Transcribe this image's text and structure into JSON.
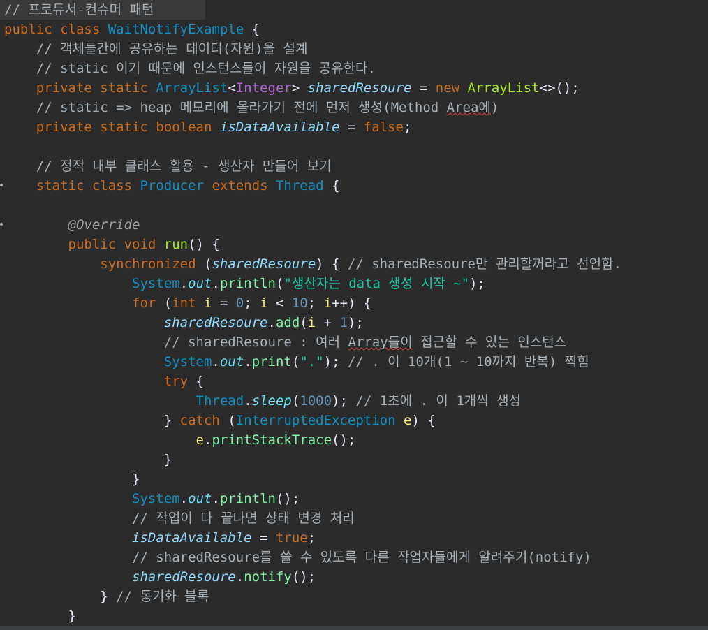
{
  "editor": {
    "lines": [
      [
        {
          "t": "// 프로듀서-컨슈머 패턴",
          "c": "c"
        }
      ],
      [
        {
          "t": "public ",
          "c": "k"
        },
        {
          "t": "class ",
          "c": "k"
        },
        {
          "t": "WaitNotifyExample",
          "c": "cls"
        },
        {
          "t": " {",
          "c": "plain"
        }
      ],
      [
        {
          "t": "    // 객체들간에 공유하는 데이터(자원)을 설계",
          "c": "c"
        }
      ],
      [
        {
          "t": "    // static 이기 때문에 인스턴스들이 자원을 공유한다.",
          "c": "c"
        }
      ],
      [
        {
          "t": "    private ",
          "c": "k"
        },
        {
          "t": "static ",
          "c": "k"
        },
        {
          "t": "ArrayList",
          "c": "cls"
        },
        {
          "t": "<",
          "c": "plain"
        },
        {
          "t": "Integer",
          "c": "gen"
        },
        {
          "t": "> ",
          "c": "plain"
        },
        {
          "t": "sharedResoure",
          "c": "sv"
        },
        {
          "t": " = ",
          "c": "plain"
        },
        {
          "t": "new ",
          "c": "k"
        },
        {
          "t": "ArrayList",
          "c": "m"
        },
        {
          "t": "<>();",
          "c": "plain"
        }
      ],
      [
        {
          "t": "    // static => heap 메모리에 올라가기 전에 먼저 생성(Method ",
          "c": "c"
        },
        {
          "t": "Area에",
          "c": "c",
          "u": true
        },
        {
          "t": ")",
          "c": "c"
        }
      ],
      [
        {
          "t": "    private ",
          "c": "k"
        },
        {
          "t": "static ",
          "c": "k"
        },
        {
          "t": "boolean ",
          "c": "k"
        },
        {
          "t": "isDataAvailable",
          "c": "sv"
        },
        {
          "t": " = ",
          "c": "plain"
        },
        {
          "t": "false",
          "c": "k"
        },
        {
          "t": ";",
          "c": "plain"
        }
      ],
      [
        {
          "t": "",
          "c": "plain"
        }
      ],
      [
        {
          "t": "    // 정적 내부 클래스 활용 - 생산자 만들어 보기",
          "c": "c"
        }
      ],
      [
        {
          "t": "    static ",
          "c": "k"
        },
        {
          "t": "class ",
          "c": "k"
        },
        {
          "t": "Producer ",
          "c": "cls"
        },
        {
          "t": "extends ",
          "c": "k"
        },
        {
          "t": "Thread",
          "c": "cls"
        },
        {
          "t": " {",
          "c": "plain"
        }
      ],
      [
        {
          "t": "",
          "c": "plain"
        }
      ],
      [
        {
          "t": "        @Override",
          "c": "ann"
        }
      ],
      [
        {
          "t": "        public ",
          "c": "k"
        },
        {
          "t": "void ",
          "c": "k"
        },
        {
          "t": "run",
          "c": "m"
        },
        {
          "t": "() {",
          "c": "plain"
        }
      ],
      [
        {
          "t": "            synchronized ",
          "c": "k"
        },
        {
          "t": "(",
          "c": "plain"
        },
        {
          "t": "sharedResoure",
          "c": "sv"
        },
        {
          "t": ") { ",
          "c": "plain"
        },
        {
          "t": "// sharedResoure만 관리할꺼라고 선언함.",
          "c": "c"
        }
      ],
      [
        {
          "t": "                System",
          "c": "cls"
        },
        {
          "t": ".",
          "c": "plain"
        },
        {
          "t": "out",
          "c": "fld"
        },
        {
          "t": ".",
          "c": "plain"
        },
        {
          "t": "println",
          "c": "m2"
        },
        {
          "t": "(",
          "c": "plain"
        },
        {
          "t": "\"생산자는 data 생성 시작 ~\"",
          "c": "str"
        },
        {
          "t": ");",
          "c": "plain"
        }
      ],
      [
        {
          "t": "                for ",
          "c": "k"
        },
        {
          "t": "(",
          "c": "plain"
        },
        {
          "t": "int ",
          "c": "k"
        },
        {
          "t": "i",
          "c": "var"
        },
        {
          "t": " = ",
          "c": "plain"
        },
        {
          "t": "0",
          "c": "num"
        },
        {
          "t": "; ",
          "c": "plain"
        },
        {
          "t": "i",
          "c": "var"
        },
        {
          "t": " < ",
          "c": "plain"
        },
        {
          "t": "10",
          "c": "num"
        },
        {
          "t": "; ",
          "c": "plain"
        },
        {
          "t": "i",
          "c": "var"
        },
        {
          "t": "++) {",
          "c": "plain"
        }
      ],
      [
        {
          "t": "                    sharedResoure",
          "c": "sv"
        },
        {
          "t": ".",
          "c": "plain"
        },
        {
          "t": "add",
          "c": "m2"
        },
        {
          "t": "(",
          "c": "plain"
        },
        {
          "t": "i",
          "c": "var"
        },
        {
          "t": " + ",
          "c": "plain"
        },
        {
          "t": "1",
          "c": "num"
        },
        {
          "t": ");",
          "c": "plain"
        }
      ],
      [
        {
          "t": "                    // sharedResoure : 여러 ",
          "c": "c"
        },
        {
          "t": "Array들이",
          "c": "c",
          "u": true
        },
        {
          "t": " 접근할 수 있는 인스턴스",
          "c": "c"
        }
      ],
      [
        {
          "t": "                    System",
          "c": "cls"
        },
        {
          "t": ".",
          "c": "plain"
        },
        {
          "t": "out",
          "c": "fld"
        },
        {
          "t": ".",
          "c": "plain"
        },
        {
          "t": "print",
          "c": "m2"
        },
        {
          "t": "(",
          "c": "plain"
        },
        {
          "t": "\".\"",
          "c": "str"
        },
        {
          "t": "); ",
          "c": "plain"
        },
        {
          "t": "// . 이 10개(1 ~ 10까지 반복) 찍힘",
          "c": "c"
        }
      ],
      [
        {
          "t": "                    try ",
          "c": "k"
        },
        {
          "t": "{",
          "c": "plain"
        }
      ],
      [
        {
          "t": "                        Thread",
          "c": "cls"
        },
        {
          "t": ".",
          "c": "plain"
        },
        {
          "t": "sleep",
          "c": "fld"
        },
        {
          "t": "(",
          "c": "plain"
        },
        {
          "t": "1000",
          "c": "num"
        },
        {
          "t": "); ",
          "c": "plain"
        },
        {
          "t": "// 1초에 . 이 1개씩 생성",
          "c": "c"
        }
      ],
      [
        {
          "t": "                    } ",
          "c": "plain"
        },
        {
          "t": "catch ",
          "c": "k"
        },
        {
          "t": "(",
          "c": "plain"
        },
        {
          "t": "InterruptedException ",
          "c": "cls"
        },
        {
          "t": "e",
          "c": "var"
        },
        {
          "t": ") {",
          "c": "plain"
        }
      ],
      [
        {
          "t": "                        e",
          "c": "var"
        },
        {
          "t": ".",
          "c": "plain"
        },
        {
          "t": "printStackTrace",
          "c": "m2"
        },
        {
          "t": "();",
          "c": "plain"
        }
      ],
      [
        {
          "t": "                    }",
          "c": "plain"
        }
      ],
      [
        {
          "t": "                }",
          "c": "plain"
        }
      ],
      [
        {
          "t": "                System",
          "c": "cls"
        },
        {
          "t": ".",
          "c": "plain"
        },
        {
          "t": "out",
          "c": "fld"
        },
        {
          "t": ".",
          "c": "plain"
        },
        {
          "t": "println",
          "c": "m2"
        },
        {
          "t": "();",
          "c": "plain"
        }
      ],
      [
        {
          "t": "                // 작업이 다 끝나면 상태 변경 처리",
          "c": "c"
        }
      ],
      [
        {
          "t": "                isDataAvailable",
          "c": "sv"
        },
        {
          "t": " = ",
          "c": "plain"
        },
        {
          "t": "true",
          "c": "k"
        },
        {
          "t": ";",
          "c": "plain"
        }
      ],
      [
        {
          "t": "                // sharedResoure를 쓸 수 있도록 다른 작업자들에게 알려주기(notify)",
          "c": "c"
        }
      ],
      [
        {
          "t": "                sharedResoure",
          "c": "sv"
        },
        {
          "t": ".",
          "c": "plain"
        },
        {
          "t": "notify",
          "c": "m2"
        },
        {
          "t": "();",
          "c": "plain"
        }
      ],
      [
        {
          "t": "            } ",
          "c": "plain"
        },
        {
          "t": "// 동기화 블록",
          "c": "c"
        }
      ],
      [
        {
          "t": "        }",
          "c": "plain"
        }
      ]
    ]
  },
  "colors": {
    "background": "#2b2b2b",
    "comment": "#a5b0b8",
    "keyword": "#cc6c1d",
    "class": "#1290c3",
    "string": "#17c6a3"
  }
}
